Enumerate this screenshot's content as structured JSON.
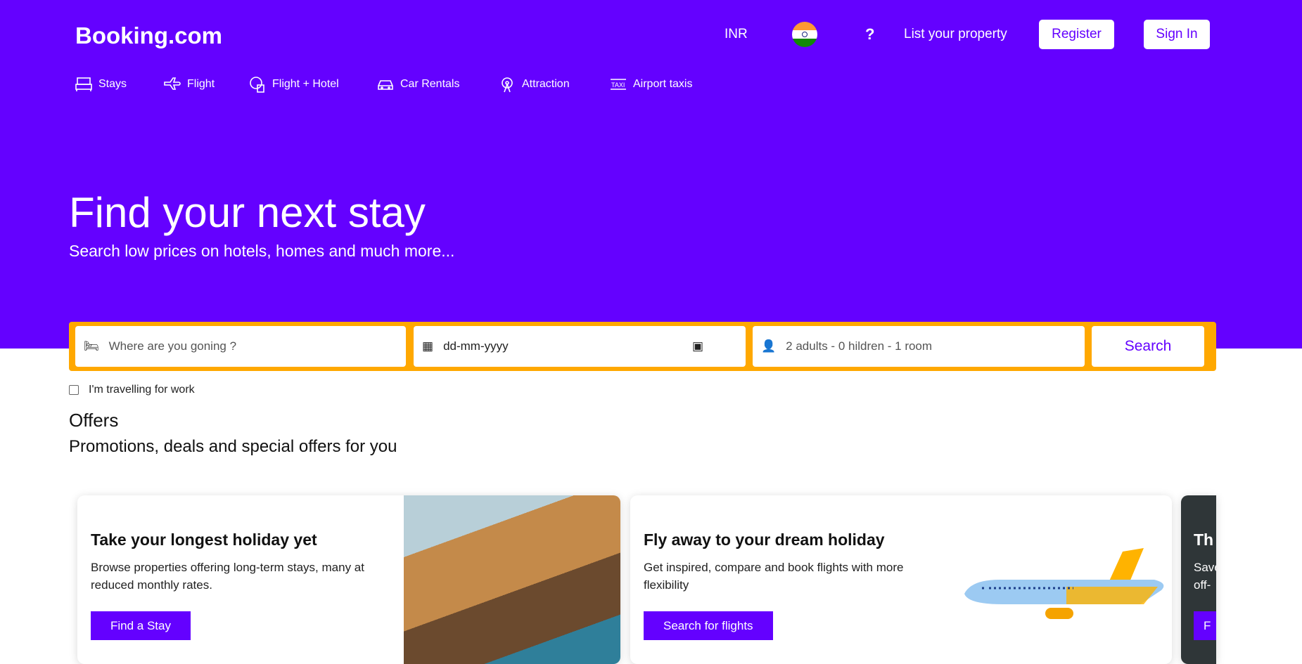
{
  "header": {
    "logo": "Booking.com",
    "currency": "INR",
    "help": "?",
    "list_property": "List your property",
    "register": "Register",
    "sign_in": "Sign In"
  },
  "nav": [
    {
      "label": "Stays",
      "icon": "bed-icon"
    },
    {
      "label": "Flight",
      "icon": "plane-icon"
    },
    {
      "label": "Flight + Hotel",
      "icon": "globe-luggage-icon"
    },
    {
      "label": "Car Rentals",
      "icon": "car-icon"
    },
    {
      "label": "Attraction",
      "icon": "ferris-wheel-icon"
    },
    {
      "label": "Airport taxis",
      "icon": "taxi-icon"
    }
  ],
  "hero": {
    "title": "Find your next stay",
    "subtitle": "Search low prices on hotels, homes and much more..."
  },
  "search": {
    "destination_placeholder": "Where are you goning ?",
    "date_placeholder": "dd-mm-yyyy",
    "guests": "2 adults - 0 hildren - 1 room",
    "button": "Search"
  },
  "work_checkbox": {
    "label": "I'm travelling for work",
    "checked": false
  },
  "offers": {
    "title": "Offers",
    "subtitle": "Promotions, deals and special offers for you",
    "cards": [
      {
        "title": "Take your longest holiday yet",
        "text": "Browse properties offering long-term stays, many at reduced monthly rates.",
        "button": "Find a Stay"
      },
      {
        "title": "Fly away to your dream holiday",
        "text": "Get inspired, compare and book flights with more flexibility",
        "button": "Search for flights"
      },
      {
        "title": "Th",
        "text": "Save off-",
        "button": "F"
      }
    ]
  },
  "colors": {
    "brand": "#6401ff",
    "accent": "#ffa800"
  }
}
